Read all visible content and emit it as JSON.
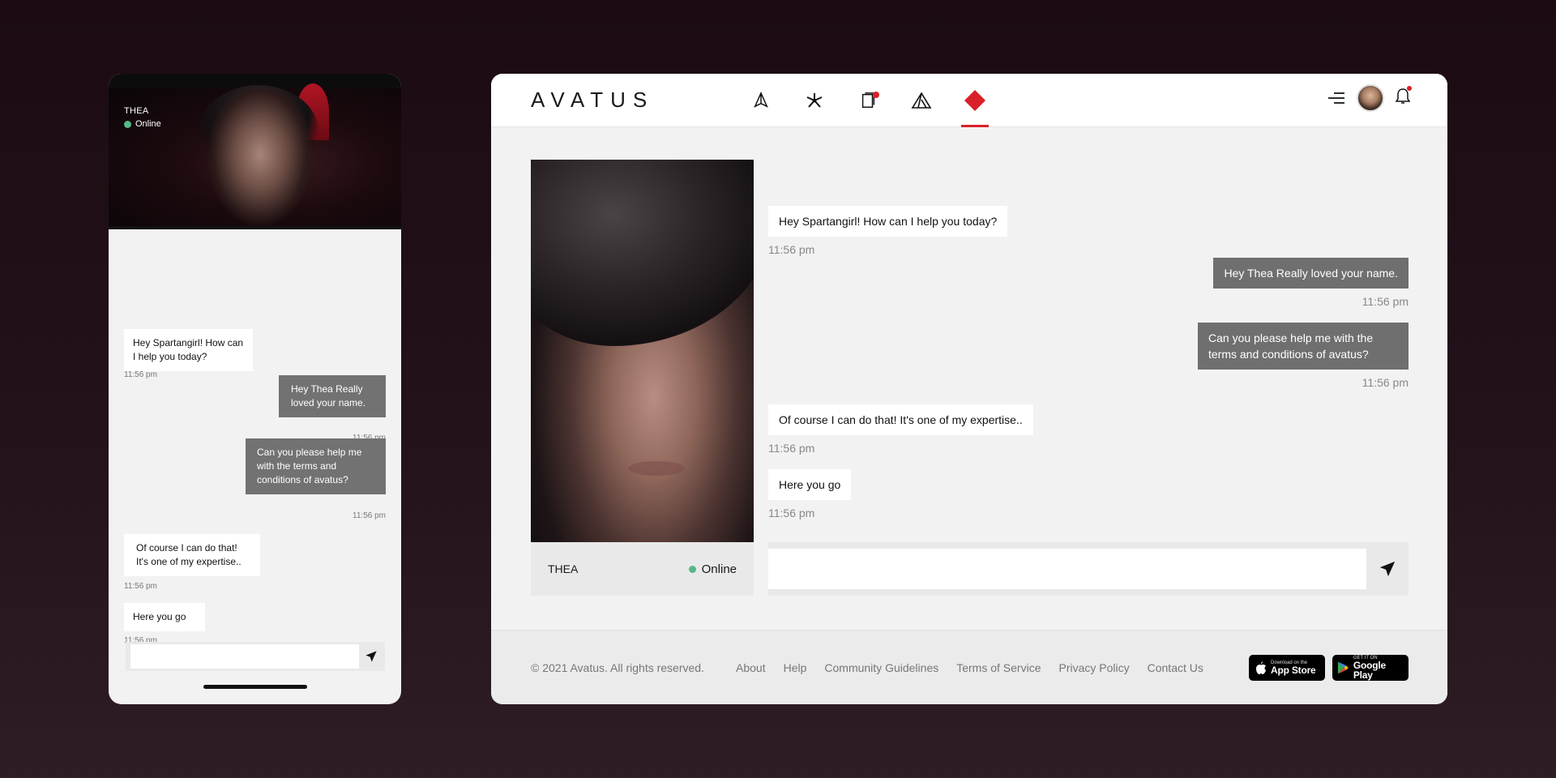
{
  "colors": {
    "accent": "#d9202a",
    "online": "#56b889",
    "outgoing_bubble": "#727272",
    "incoming_bubble": "#ffffff",
    "panel_bg": "#f2f2f2"
  },
  "mobile": {
    "assistant_name": "THEA",
    "status": "Online",
    "messages": [
      {
        "dir": "in",
        "text": "Hey Spartangirl! How can I help you today?",
        "time": "11:56 pm"
      },
      {
        "dir": "out",
        "text": "Hey Thea Really loved your name.",
        "time": "11:56 pm"
      },
      {
        "dir": "out",
        "text": "Can you please help me with the terms and conditions of avatus?",
        "time": "11:56 pm"
      },
      {
        "dir": "in",
        "text": "Of course I can do that! It's one of my expertise..",
        "time": "11:56 pm"
      },
      {
        "dir": "in",
        "text": "Here you go",
        "time": "11:56 pm"
      }
    ],
    "input_placeholder": "",
    "icons": {
      "send": "send-icon"
    }
  },
  "desktop": {
    "logo": "AVATUS",
    "nav": [
      {
        "icon": "pyramid-icon",
        "active": false
      },
      {
        "icon": "network-icon",
        "active": false
      },
      {
        "icon": "document-icon",
        "active": false,
        "badge": true
      },
      {
        "icon": "mountain-icon",
        "active": false
      },
      {
        "icon": "diamond-icon",
        "active": true
      }
    ],
    "header_icons": {
      "menu": "menu-icon",
      "avatar": "user-avatar",
      "notifications": "bell-icon"
    },
    "assistant_name": "THEA",
    "status": "Online",
    "messages": [
      {
        "dir": "in",
        "text": "Hey Spartangirl! How can I help you today?",
        "time": "11:56 pm"
      },
      {
        "dir": "out",
        "text": "Hey Thea Really loved your name.",
        "time": "11:56 pm"
      },
      {
        "dir": "out",
        "text": "Can you please help me with the terms and conditions of avatus?",
        "time": "11:56 pm"
      },
      {
        "dir": "in",
        "text": "Of course I can do that! It's one of my expertise..",
        "time": "11:56 pm"
      },
      {
        "dir": "in",
        "text": "Here you go",
        "time": "11:56 pm"
      }
    ],
    "input_placeholder": "",
    "footer": {
      "copyright": "© 2021 Avatus. All rights reserved.",
      "links": [
        "About",
        "Help",
        "Community Guidelines",
        "Terms of Service",
        "Privacy Policy",
        "Contact Us"
      ],
      "app_store": {
        "small": "Download on the",
        "big": "App Store"
      },
      "google_play": {
        "small": "GET IT ON",
        "big": "Google Play"
      }
    }
  }
}
